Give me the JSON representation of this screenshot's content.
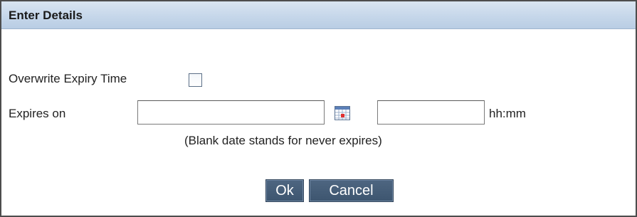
{
  "dialog": {
    "title": "Enter Details"
  },
  "form": {
    "overwrite_label": "Overwrite Expiry Time",
    "overwrite_checked": false,
    "expires_label": "Expires on",
    "date_value": "",
    "time_value": "",
    "time_unit_hint": "hh:mm",
    "note": "(Blank date stands for never expires)"
  },
  "buttons": {
    "ok_label": "Ok",
    "cancel_label": "Cancel"
  },
  "icons": {
    "calendar": "calendar-icon",
    "checkbox": "checkbox-unchecked"
  },
  "colors": {
    "title_bar": "#c6d7ea",
    "button_bg": "#3d556f",
    "border": "#4d4d4d"
  }
}
